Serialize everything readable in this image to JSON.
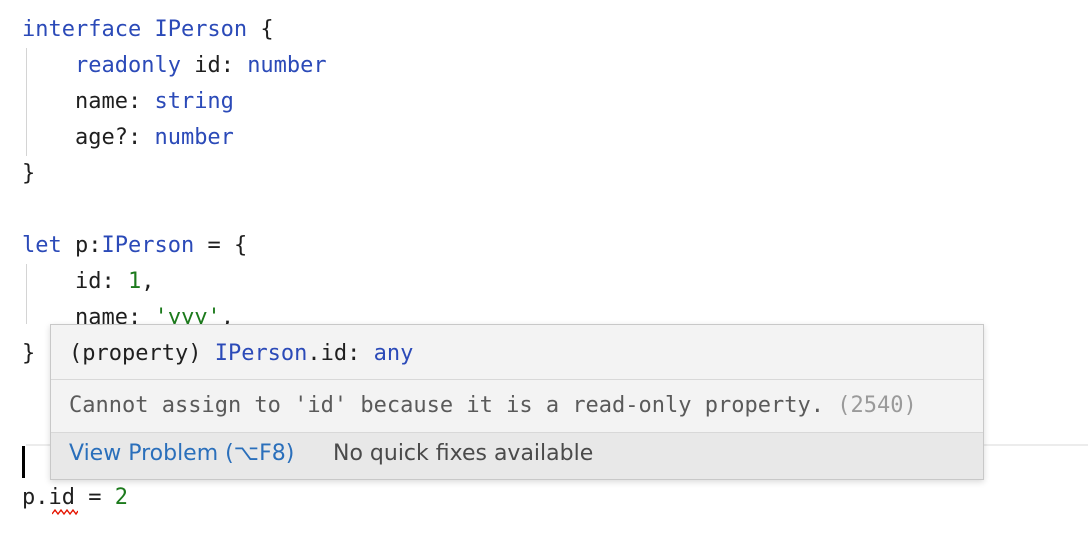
{
  "editor": {
    "lines": [
      [
        {
          "t": "interface ",
          "c": "kw"
        },
        {
          "t": "IPerson",
          "c": "kw"
        },
        {
          "t": " {",
          "c": "plain"
        }
      ],
      [
        {
          "t": "    ",
          "c": "plain"
        },
        {
          "t": "readonly",
          "c": "kw"
        },
        {
          "t": " id: ",
          "c": "plain"
        },
        {
          "t": "number",
          "c": "kw"
        }
      ],
      [
        {
          "t": "    name: ",
          "c": "plain"
        },
        {
          "t": "string",
          "c": "kw"
        }
      ],
      [
        {
          "t": "    age?: ",
          "c": "plain"
        },
        {
          "t": "number",
          "c": "kw"
        }
      ],
      [
        {
          "t": "}",
          "c": "plain"
        }
      ],
      [],
      [
        {
          "t": "let ",
          "c": "kw"
        },
        {
          "t": "p:",
          "c": "plain"
        },
        {
          "t": "IPerson",
          "c": "kw"
        },
        {
          "t": " = {",
          "c": "plain"
        }
      ],
      [
        {
          "t": "    id: ",
          "c": "plain"
        },
        {
          "t": "1",
          "c": "num"
        },
        {
          "t": ",",
          "c": "plain"
        }
      ],
      [
        {
          "t": "    name: ",
          "c": "plain"
        },
        {
          "t": "'yyy'",
          "c": "str"
        },
        {
          "t": ",",
          "c": "plain"
        }
      ],
      [
        {
          "t": "}",
          "c": "plain"
        }
      ],
      [],
      [],
      [],
      [
        {
          "t": "p.",
          "c": "plain"
        },
        {
          "t": "id",
          "c": "plain"
        },
        {
          "t": " = ",
          "c": "plain"
        },
        {
          "t": "2",
          "c": "num"
        }
      ]
    ]
  },
  "hover": {
    "signature_prefix": "(property) ",
    "signature_type": "IPerson",
    "signature_member": ".id: ",
    "signature_value": "any",
    "message": "Cannot assign to 'id' because it is a read-only property. ",
    "error_code": "(2540)",
    "view_problem": "View Problem (⌥F8)",
    "no_fixes": "No quick fixes available"
  },
  "colors": {
    "keyword": "#2b4ab8",
    "number": "#1c7a1c",
    "link": "#2a6fbb",
    "error": "#e51400"
  }
}
